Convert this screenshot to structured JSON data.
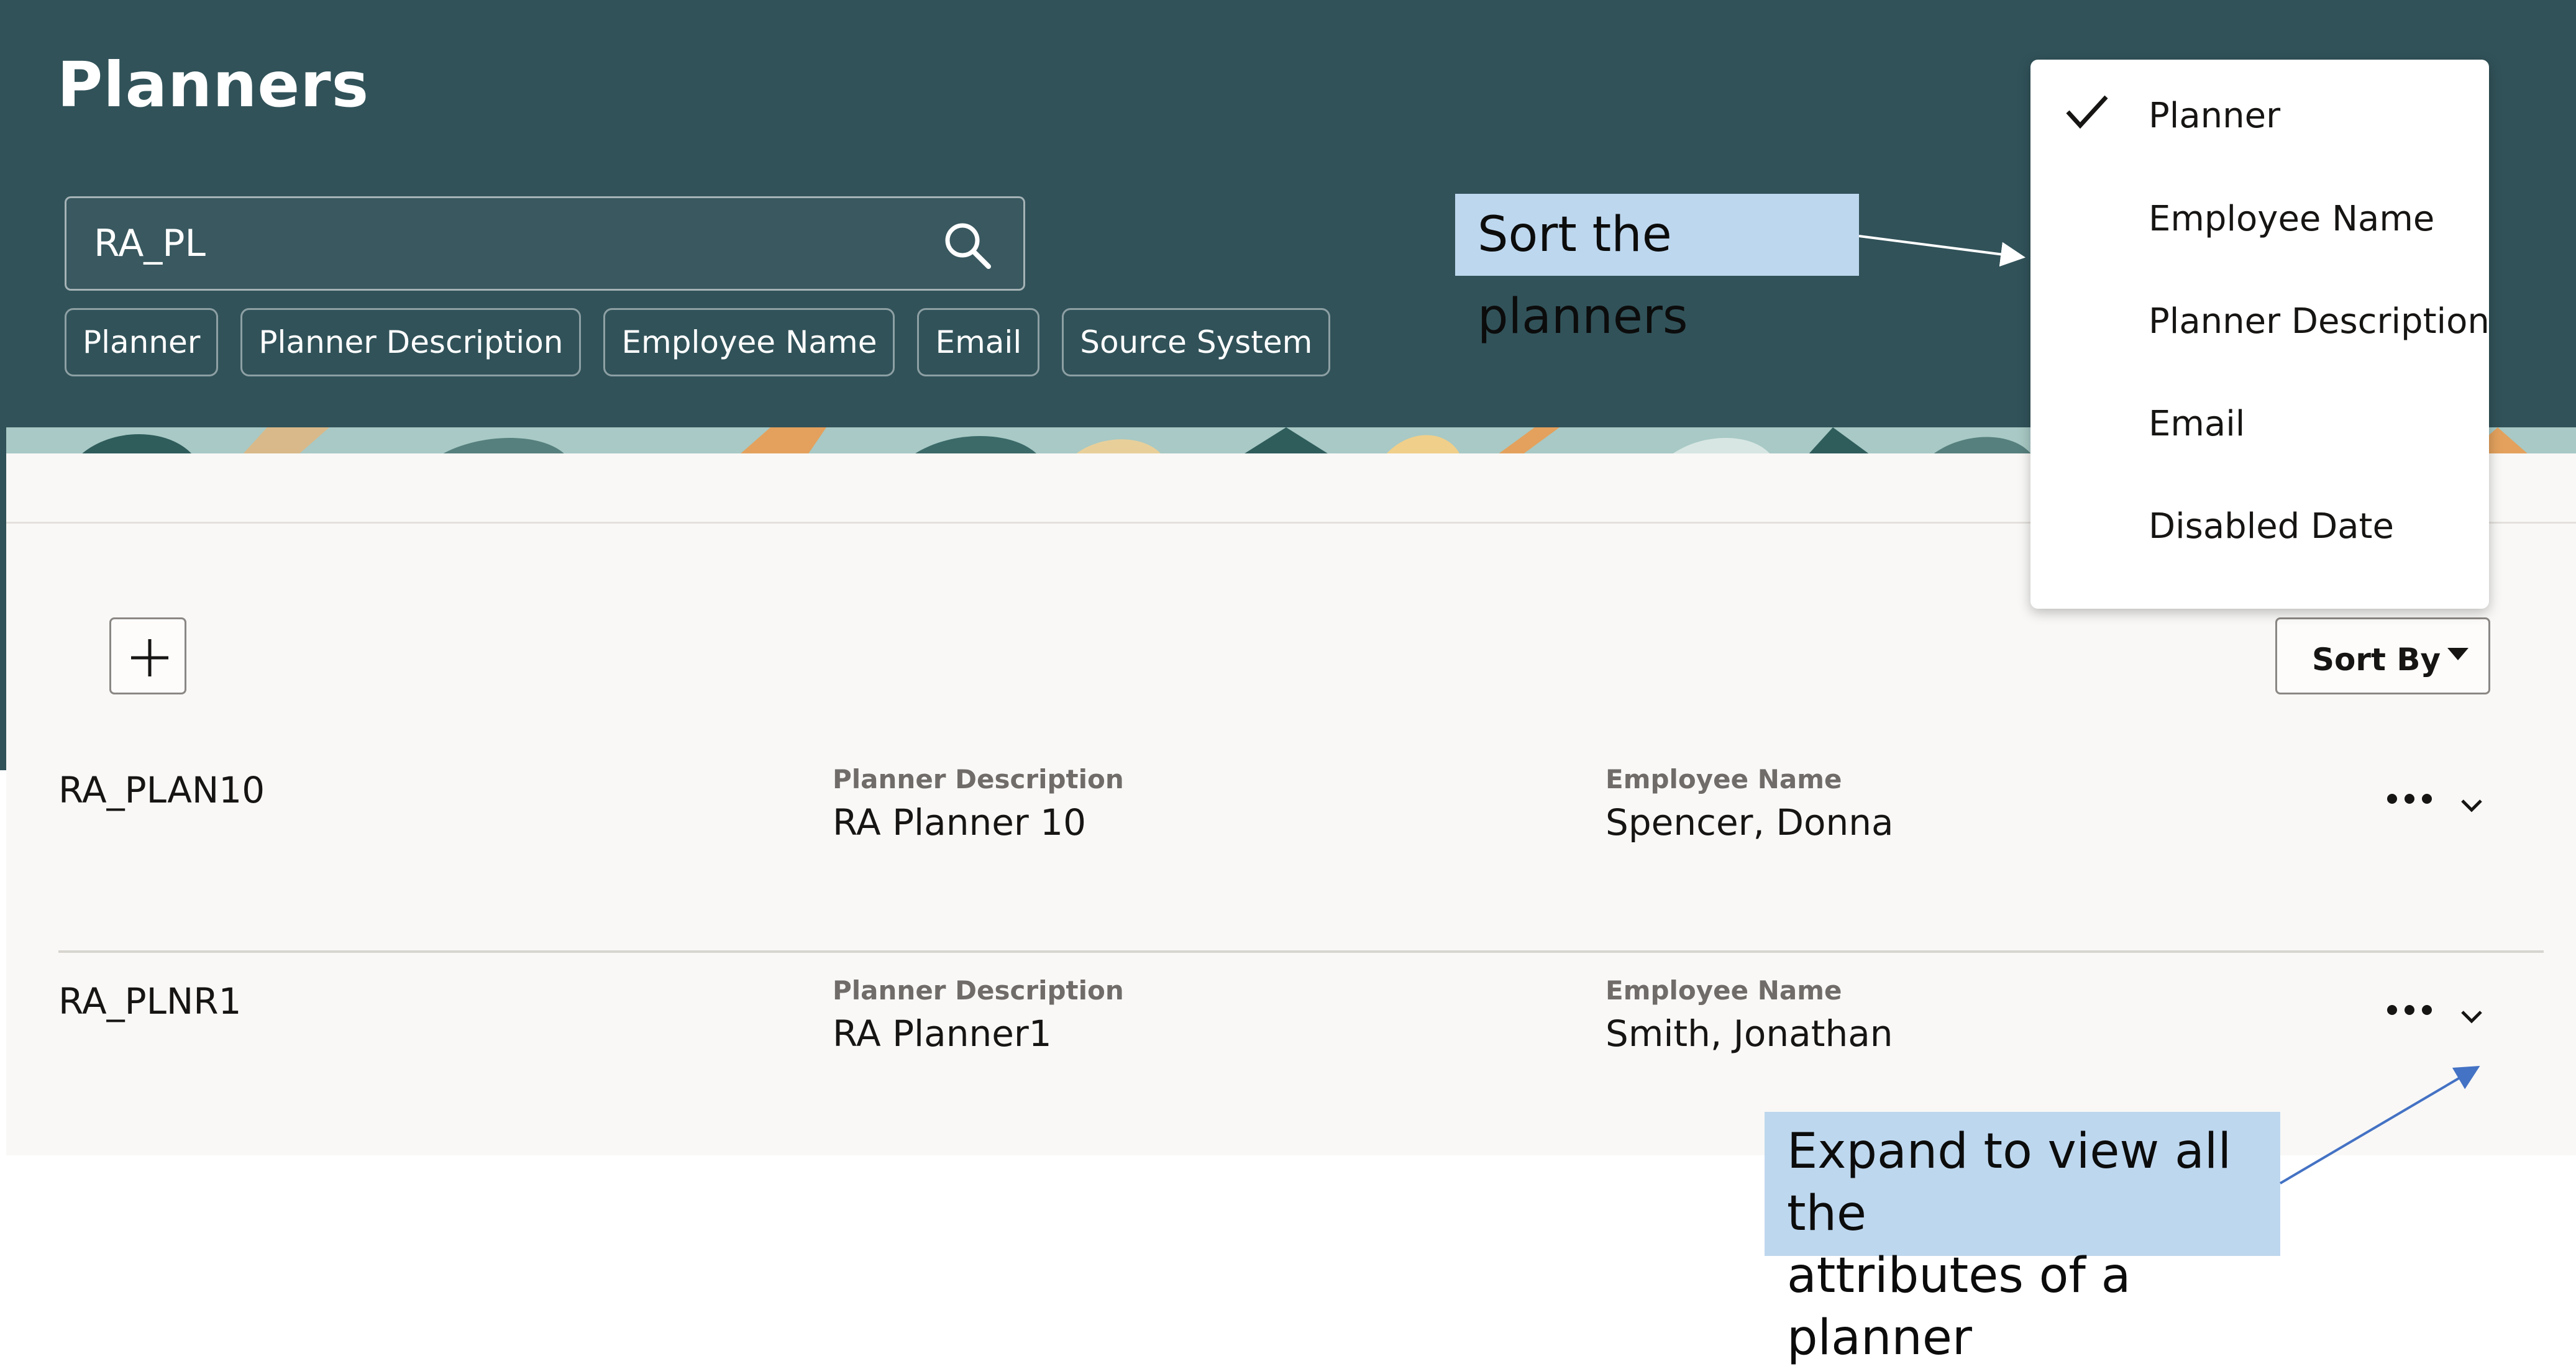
{
  "header": {
    "title": "Planners",
    "search": {
      "value": "RA_PL"
    },
    "filter_chips": [
      "Planner",
      "Planner Description",
      "Employee Name",
      "Email",
      "Source System"
    ]
  },
  "toolbar": {
    "add_icon": "plus-icon",
    "sort_label": "Sort By"
  },
  "sort_menu": {
    "selected": "Planner",
    "items": [
      "Planner",
      "Employee Name",
      "Planner Description",
      "Email",
      "Disabled Date"
    ]
  },
  "rows": [
    {
      "planner": "RA_PLAN10",
      "description_label": "Planner Description",
      "description": "RA Planner 10",
      "employee_label": "Employee Name",
      "employee": "Spencer, Donna"
    },
    {
      "planner": "RA_PLNR1",
      "description_label": "Planner Description",
      "description": "RA Planner1",
      "employee_label": "Employee Name",
      "employee": "Smith, Jonathan"
    }
  ],
  "callouts": {
    "sort": "Sort the planners",
    "expand_line1": "Expand to view all the",
    "expand_line2": "attributes of a planner"
  },
  "colors": {
    "header_bg": "#315259",
    "content_bg": "#f9f8f6",
    "callout_bg": "#bdd7ee",
    "arrow_blue": "#4472c4"
  }
}
